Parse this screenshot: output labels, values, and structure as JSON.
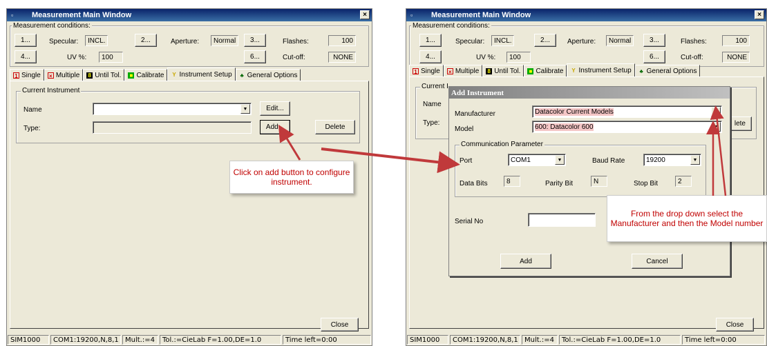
{
  "window_left": {
    "title": "Measurement Main Window",
    "close_glyph": "×",
    "conditions": {
      "group_label": "Measurement conditions:",
      "btn1": "1...",
      "btn2": "2...",
      "btn3": "3...",
      "btn4": "4...",
      "btn6": "6...",
      "specular_label": "Specular:",
      "specular_value": "INCL.",
      "aperture_label": "Aperture:",
      "aperture_value": "Normal",
      "flashes_label": "Flashes:",
      "flashes_value": "100",
      "uv_label": "UV %:",
      "uv_value": "100",
      "cutoff_label": "Cut-off:",
      "cutoff_value": "NONE"
    },
    "tabs": [
      "Single",
      "Multiple",
      "Until Tol.",
      "Calibrate",
      "Instrument Setup",
      "General Options"
    ],
    "current_instrument": {
      "group_label": "Current Instrument",
      "name_label": "Name",
      "name_value": "",
      "type_label": "Type:",
      "type_value": "",
      "edit_button": "Edit...",
      "add_button": "Add...",
      "delete_button": "Delete"
    },
    "close_button": "Close",
    "status": [
      "SIM1000",
      "COM1:19200,N,8,1",
      "Mult.:=4",
      "Tol.:=CieLab F=1.00,DE=1.0",
      "Time left=0:00"
    ]
  },
  "window_right": {
    "title": "Measurement Main Window",
    "close_glyph": "×",
    "conditions": {
      "group_label": "Measurement conditions:",
      "btn1": "1...",
      "btn2": "2...",
      "btn3": "3...",
      "btn4": "4...",
      "btn6": "6...",
      "specular_label": "Specular:",
      "specular_value": "INCL.",
      "aperture_label": "Aperture:",
      "aperture_value": "Normal",
      "flashes_label": "Flashes:",
      "flashes_value": "100",
      "uv_label": "UV %:",
      "uv_value": "100",
      "cutoff_label": "Cut-off:",
      "cutoff_value": "NONE"
    },
    "tabs": [
      "Single",
      "Multiple",
      "Until Tol.",
      "Calibrate",
      "Instrument Setup",
      "General Options"
    ],
    "current_instrument": {
      "group_label_partial": "Current I",
      "name_label": "Name",
      "type_label": "Type:",
      "delete_partial": "lete"
    },
    "close_button": "Close",
    "status": [
      "SIM1000",
      "COM1:19200,N,8,1",
      "Mult.:=4",
      "Tol.:=CieLab F=1.00,DE=1.0",
      "Time left=0:00"
    ]
  },
  "dialog": {
    "title": "Add Instrument",
    "manufacturer_label": "Manufacturer",
    "manufacturer_value": "Datacolor Current Models",
    "model_label": "Model",
    "model_value": "600:  Datacolor 600",
    "comm_group_label": "Communication Parameter",
    "port_label": "Port",
    "port_value": "COM1",
    "baud_label": "Baud Rate",
    "baud_value": "19200",
    "databits_label": "Data Bits",
    "databits_value": "8",
    "parity_label": "Parity Bit",
    "parity_value": "N",
    "stopbit_label": "Stop Bit",
    "stopbit_value": "2",
    "serial_label": "Serial No",
    "serial_value": "",
    "add_button": "Add",
    "cancel_button": "Cancel"
  },
  "callouts": {
    "left": "Click on add button to configure instrument.",
    "right": "From the drop down select the Manufacturer and then the Model number"
  },
  "colors": {
    "arrow": "#c0393b",
    "callout_text": "#c00000",
    "title_bar": "#0a246a",
    "highlight": "#f4c6c6"
  }
}
